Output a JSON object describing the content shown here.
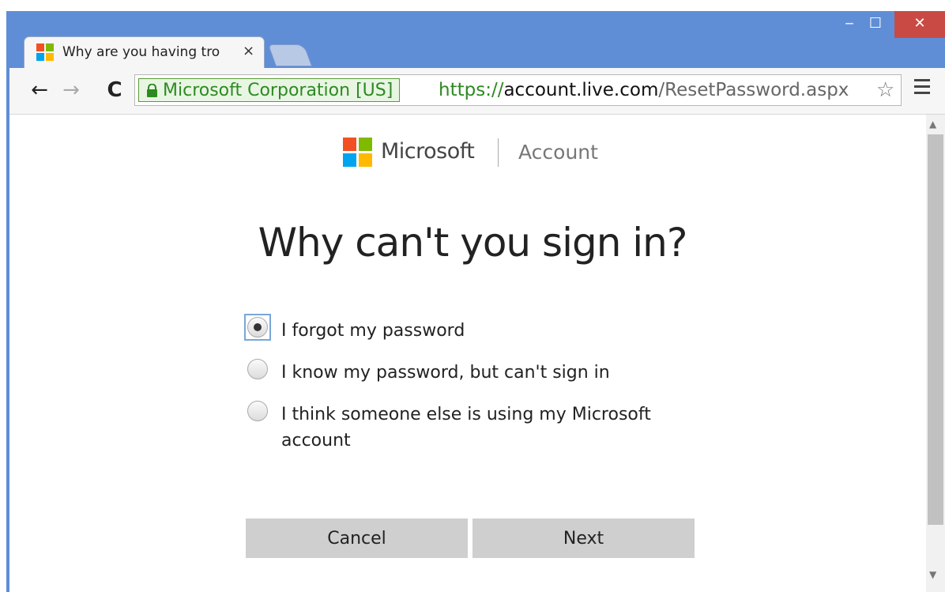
{
  "browser": {
    "tab_title": "Why are you having tro",
    "tab_close": "×",
    "window_controls": {
      "minimize": "‒",
      "maximize": "☐",
      "close": "✕"
    },
    "nav": {
      "back": "←",
      "forward": "→",
      "reload": "C"
    },
    "ev_label": "Microsoft Corporation [US]",
    "url": {
      "scheme": "https://",
      "host": "account.live.com",
      "path": "/ResetPassword.aspx"
    },
    "bookmark_star": "☆",
    "scroll_up": "▲",
    "scroll_down": "▼"
  },
  "page": {
    "brand_name": "Microsoft",
    "brand_section": "Account",
    "heading": "Why can't you sign in?",
    "options": [
      {
        "label": "I forgot my password",
        "selected": true
      },
      {
        "label": "I know my password, but can't sign in",
        "selected": false
      },
      {
        "label": "I think someone else is using my Microsoft",
        "label_line2": "account",
        "selected": false
      }
    ],
    "buttons": {
      "cancel": "Cancel",
      "next": "Next"
    }
  },
  "colors": {
    "titlebar": "#5f8ed6",
    "close": "#c94a44",
    "ev_green": "#2d8a21",
    "button_gray": "#cfcfcf",
    "ms_red": "#f25022",
    "ms_green": "#7fba00",
    "ms_blue": "#00a4ef",
    "ms_yellow": "#ffb900"
  }
}
